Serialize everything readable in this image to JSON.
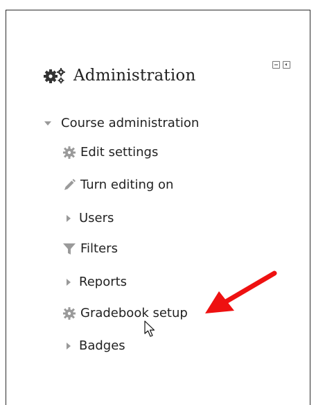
{
  "block": {
    "title": "Administration",
    "title_icon": "cogs-icon",
    "controls": [
      {
        "name": "hide-block-icon"
      },
      {
        "name": "dock-block-icon"
      }
    ]
  },
  "tree": {
    "root": {
      "label": "Course administration",
      "icon": "expanded-triangle-icon"
    },
    "items": [
      {
        "label": "Edit settings",
        "icon": "gear-icon"
      },
      {
        "label": "Turn editing on",
        "icon": "pencil-icon"
      },
      {
        "label": "Users",
        "icon": "collapsed-triangle-icon"
      },
      {
        "label": "Filters",
        "icon": "filter-icon"
      },
      {
        "label": "Reports",
        "icon": "collapsed-triangle-icon"
      },
      {
        "label": "Gradebook setup",
        "icon": "gear-icon"
      },
      {
        "label": "Badges",
        "icon": "collapsed-triangle-icon"
      }
    ]
  },
  "annotation": {
    "color": "#ee1111",
    "icon": "red-arrow-icon"
  },
  "colors": {
    "text": "#222222",
    "icon_gray": "#9a9a9a"
  }
}
